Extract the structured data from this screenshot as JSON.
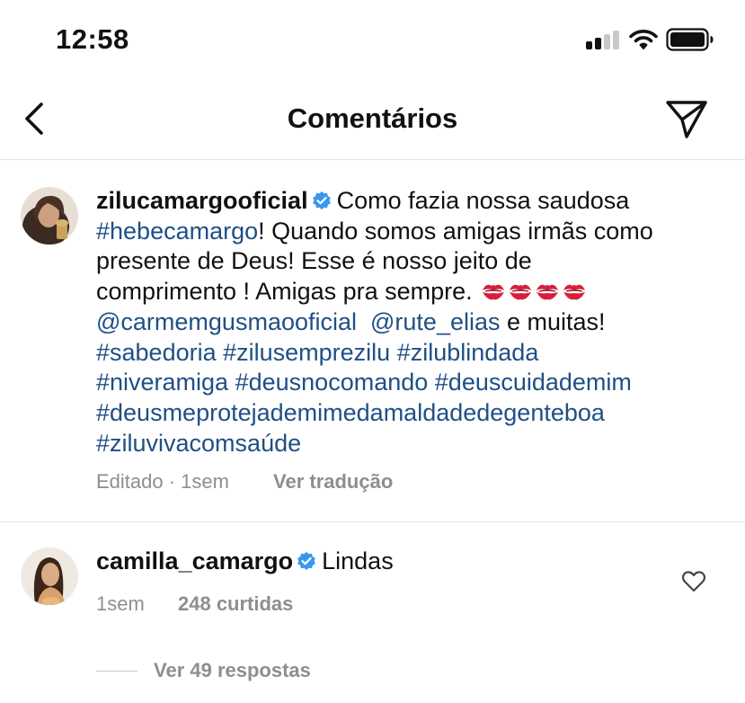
{
  "status_bar": {
    "time": "12:58"
  },
  "header": {
    "title": "Comentários"
  },
  "caption": {
    "username": "zilucamargooficial",
    "verified": true,
    "text_1": "Como fazia nossa saudosa",
    "hashtag_1": "#hebecamargo",
    "text_2": "! Quando somos amigas irmãs como",
    "text_3": "presente de Deus! Esse é nosso jeito de",
    "text_4": "comprimento ! Amigas pra sempre.",
    "mention_1": "@carmemgusmaooficial",
    "mention_2": "@rute_elias",
    "text_5": "e muitas!",
    "hashtags": [
      "#sabedoria",
      "#zilusemprezilu",
      "#zilublindada",
      "#niveramiga",
      "#deusnocomando",
      "#deuscuidademim",
      "#deusmeprotejademimedamaldadedegenteboa",
      "#ziluvivacomsaúde"
    ],
    "meta_edited": "Editado · 1sem",
    "see_translation": "Ver tradução"
  },
  "comment": {
    "username": "camilla_camargo",
    "verified": true,
    "text": "Lindas",
    "time": "1sem",
    "likes": "248 curtidas",
    "view_replies": "Ver 49 respostas"
  },
  "colors": {
    "hashtag": "#1f4f86",
    "verified": "#3897f0",
    "meta": "#8e8e8e",
    "kiss": "#d81e3c"
  },
  "icons": {
    "back": "chevron-left-icon",
    "send": "paper-plane-icon",
    "verified": "verified-badge-icon",
    "like": "heart-icon",
    "emoji": "kiss-mark-emoji"
  }
}
